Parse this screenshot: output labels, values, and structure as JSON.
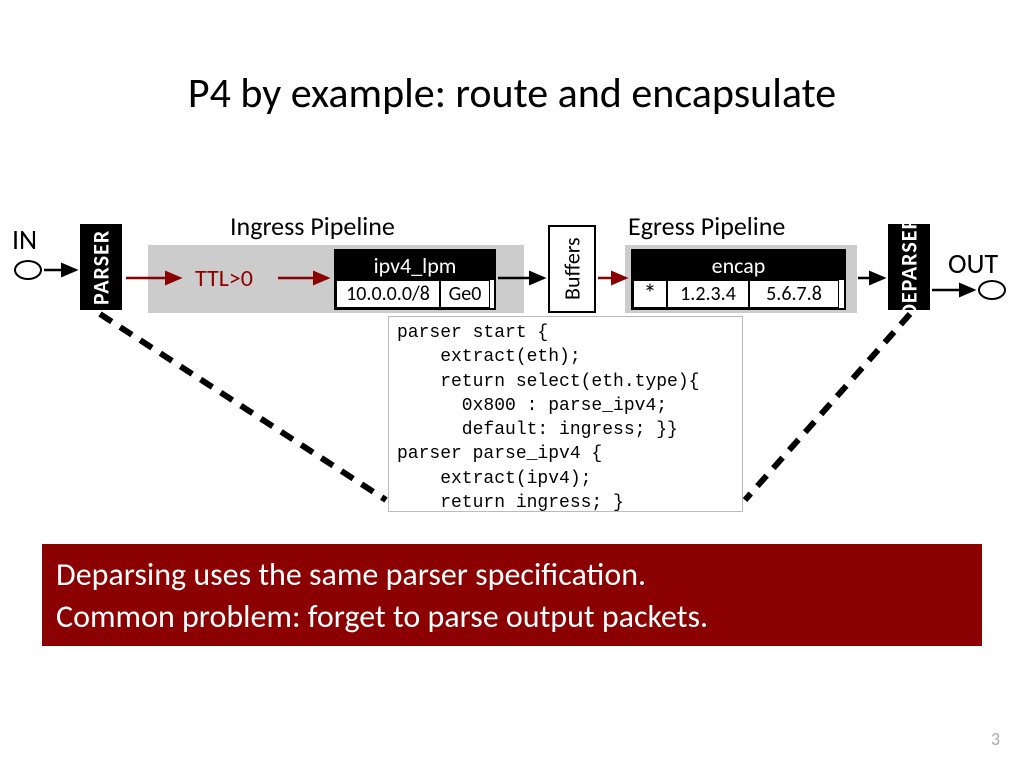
{
  "title": "P4 by example: route and encapsulate",
  "io": {
    "in": "IN",
    "out": "OUT"
  },
  "parser": "PARSER",
  "deparser": "DEPARSER",
  "buffers": "Buffers",
  "pipelines": {
    "ingress_label": "Ingress Pipeline",
    "egress_label": "Egress Pipeline",
    "ttl": "TTL>0"
  },
  "ipv4_table": {
    "header": "ipv4_lpm",
    "cell1": "10.0.0.0/8",
    "cell2": "Ge0"
  },
  "encap_table": {
    "header": "encap",
    "cell1": "*",
    "cell2": "1.2.3.4",
    "cell3": "5.6.7.8"
  },
  "code": "parser start {\n    extract(eth);\n    return select(eth.type){\n      0x800 : parse_ipv4;\n      default: ingress; }}\nparser parse_ipv4 {\n    extract(ipv4);\n    return ingress; }",
  "callout_line1": "Deparsing uses the same parser specification.",
  "callout_line2": "Common problem: forget to parse output packets.",
  "page_number": "3"
}
